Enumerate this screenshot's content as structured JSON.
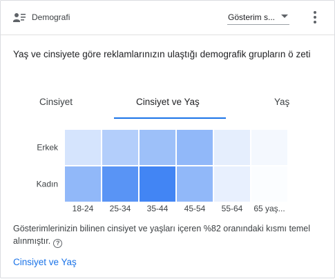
{
  "header": {
    "title": "Demografi",
    "icon": "demography-icon",
    "metric_dropdown": {
      "selected": "Gösterim s..."
    },
    "more_icon": "more-vert-icon"
  },
  "description": "Yaş ve cinsiyete göre reklamlarınızın ulaştığı demografik grupların ö zeti",
  "tabs": [
    {
      "label": "Cinsiyet",
      "active": false
    },
    {
      "label": "Cinsiyet ve Yaş",
      "active": true
    },
    {
      "label": "Yaş",
      "active": false
    }
  ],
  "chart_data": {
    "type": "heatmap",
    "rows": [
      "Erkek",
      "Kadın"
    ],
    "columns": [
      "18-24",
      "25-34",
      "35-44",
      "45-54",
      "55-64",
      "65 yaş..."
    ],
    "values": [
      [
        0.22,
        0.4,
        0.52,
        0.58,
        0.14,
        0.06
      ],
      [
        0.58,
        0.88,
        1.0,
        0.58,
        0.12,
        0.02
      ]
    ],
    "color_low": "#ffffff",
    "color_high": "#4285f4"
  },
  "note": "Gösterimlerinizin bilinen cinsiyet ve yaşları içeren %82 oranındaki kısmı temel alınmıştır.",
  "help_icon": "help-circle-icon",
  "help_glyph": "?",
  "footer_link": "Cinsiyet ve Yaş"
}
